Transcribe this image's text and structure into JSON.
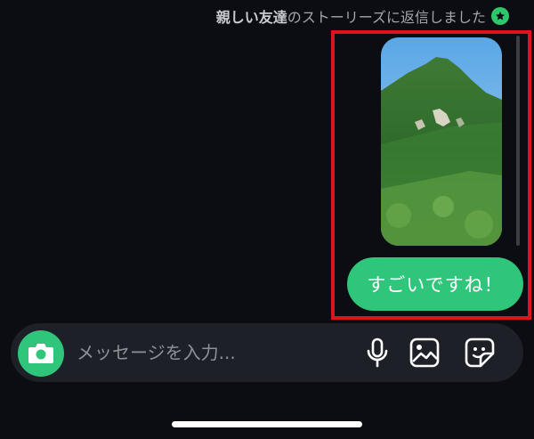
{
  "story_reply": {
    "close_friends_label": "親しい友達",
    "reply_text": "のストーリーズに返信しました",
    "badge_icon": "star-icon",
    "accent_color": "#2fc56a"
  },
  "thread": {
    "story_thumbnail_icon": "mountain-photo",
    "message": "すごいですね！",
    "highlight_color": "#e0131b"
  },
  "composer": {
    "placeholder": "メッセージを入力...",
    "camera_icon": "camera-icon",
    "mic_icon": "microphone-icon",
    "gallery_icon": "image-icon",
    "sticker_icon": "sticker-icon"
  }
}
